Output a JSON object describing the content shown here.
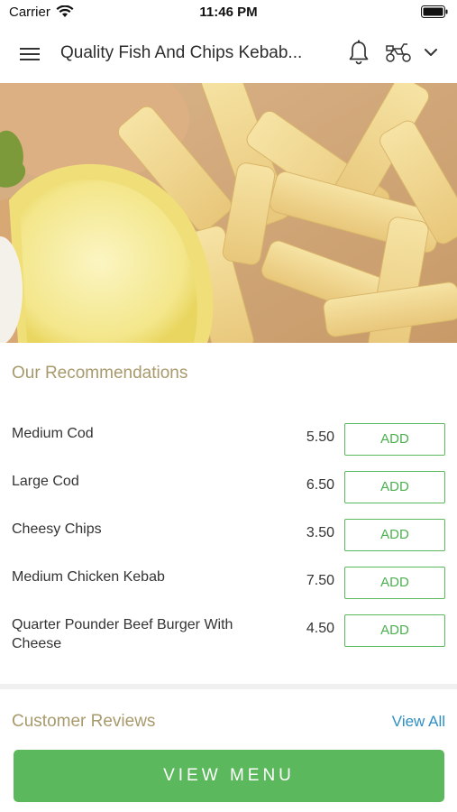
{
  "status_bar": {
    "carrier": "Carrier",
    "time": "11:46 PM"
  },
  "header": {
    "title": "Quality Fish And Chips Kebab...",
    "menu_icon": "hamburger-menu-icon",
    "notification_icon": "bell-icon",
    "delivery_icon": "scooter-icon",
    "dropdown_icon": "chevron-down-icon"
  },
  "hero": {
    "description_icon": "food-photo"
  },
  "recommendations": {
    "title": "Our Recommendations",
    "items": [
      {
        "name": "Medium Cod",
        "price": "5.50",
        "add_label": "ADD"
      },
      {
        "name": "Large Cod",
        "price": "6.50",
        "add_label": "ADD"
      },
      {
        "name": "Cheesy Chips",
        "price": "3.50",
        "add_label": "ADD"
      },
      {
        "name": "Medium Chicken Kebab",
        "price": "7.50",
        "add_label": "ADD"
      },
      {
        "name": "Quarter Pounder Beef Burger With Cheese",
        "price": "4.50",
        "add_label": "ADD"
      }
    ]
  },
  "reviews": {
    "title": "Customer Reviews",
    "view_all_label": "View All"
  },
  "footer": {
    "view_menu_label": "VIEW MENU"
  },
  "colors": {
    "accent_green": "#5cb85c",
    "section_title": "#a89a6c",
    "link_blue": "#2f8fc4"
  }
}
